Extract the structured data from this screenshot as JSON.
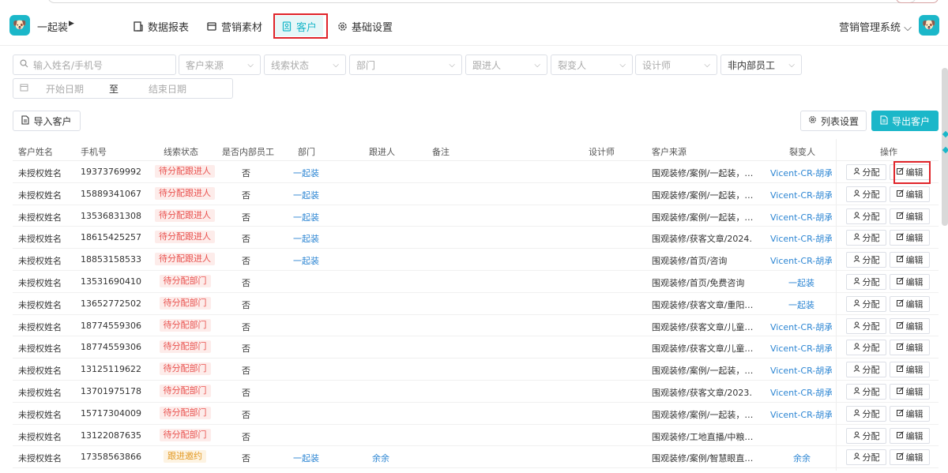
{
  "header": {
    "brand": "一起装",
    "nav": [
      {
        "label": "数据报表",
        "icon": "report-icon"
      },
      {
        "label": "营销素材",
        "icon": "material-icon"
      },
      {
        "label": "客户",
        "icon": "customer-icon",
        "active": true
      },
      {
        "label": "基础设置",
        "icon": "gear-icon"
      }
    ],
    "system": "营销管理系统",
    "accent": "#1bb7c9"
  },
  "filters": {
    "search_placeholder": "输入姓名/手机号",
    "source": "客户来源",
    "status": "线索状态",
    "dept": "部门",
    "follower": "跟进人",
    "splitter": "裂变人",
    "designer": "设计师",
    "employee": "非内部员工",
    "start": "开始日期",
    "to": "至",
    "end": "结束日期"
  },
  "actions": {
    "import": "导入客户",
    "columns": "列表设置",
    "export": "导出客户"
  },
  "table": {
    "headers": [
      "客户姓名",
      "手机号",
      "线索状态",
      "是否内部员工",
      "部门",
      "跟进人",
      "备注",
      "设计师",
      "客户来源",
      "裂变人",
      "操作"
    ],
    "assign_label": "分配",
    "edit_label": "编辑",
    "rows": [
      {
        "name": "未授权姓名",
        "phone": "19373769992",
        "status": "待分配跟进人",
        "status_color": "red",
        "internal": "否",
        "dept": "一起装",
        "follower": "",
        "source": "围观装修/案例/一起装，…",
        "splitter": "Vicent-CR-胡承仁"
      },
      {
        "name": "未授权姓名",
        "phone": "15889341067",
        "status": "待分配跟进人",
        "status_color": "red",
        "internal": "否",
        "dept": "一起装",
        "follower": "",
        "source": "围观装修/案例/一起装，…",
        "splitter": "Vicent-CR-胡承仁"
      },
      {
        "name": "未授权姓名",
        "phone": "13536831308",
        "status": "待分配跟进人",
        "status_color": "red",
        "internal": "否",
        "dept": "一起装",
        "follower": "",
        "source": "围观装修/案例/一起装，…",
        "splitter": "Vicent-CR-胡承仁"
      },
      {
        "name": "未授权姓名",
        "phone": "18615425257",
        "status": "待分配跟进人",
        "status_color": "red",
        "internal": "否",
        "dept": "一起装",
        "follower": "",
        "source": "围观装修/获客文章/2024…",
        "splitter": "Vicent-CR-胡承仁"
      },
      {
        "name": "未授权姓名",
        "phone": "18853158533",
        "status": "待分配跟进人",
        "status_color": "red",
        "internal": "否",
        "dept": "一起装",
        "follower": "",
        "source": "围观装修/首页/咨询",
        "splitter": "Vicent-CR-胡承仁"
      },
      {
        "name": "未授权姓名",
        "phone": "13531690410",
        "status": "待分配部门",
        "status_color": "red",
        "internal": "否",
        "dept": "",
        "follower": "",
        "source": "围观装修/首页/免费咨询",
        "splitter": "一起装"
      },
      {
        "name": "未授权姓名",
        "phone": "13652772502",
        "status": "待分配部门",
        "status_color": "red",
        "internal": "否",
        "dept": "",
        "follower": "",
        "source": "围观装修/获客文章/重阳…",
        "splitter": "一起装"
      },
      {
        "name": "未授权姓名",
        "phone": "18774559306",
        "status": "待分配部门",
        "status_color": "red",
        "internal": "否",
        "dept": "",
        "follower": "",
        "source": "围观装修/获客文章/儿童…",
        "splitter": "Vicent-CR-胡承仁"
      },
      {
        "name": "未授权姓名",
        "phone": "18774559306",
        "status": "待分配部门",
        "status_color": "red",
        "internal": "否",
        "dept": "",
        "follower": "",
        "source": "围观装修/获客文章/儿童…",
        "splitter": "Vicent-CR-胡承仁"
      },
      {
        "name": "未授权姓名",
        "phone": "13125119622",
        "status": "待分配部门",
        "status_color": "red",
        "internal": "否",
        "dept": "",
        "follower": "",
        "source": "围观装修/案例/一起装，…",
        "splitter": "Vicent-CR-胡承仁"
      },
      {
        "name": "未授权姓名",
        "phone": "13701975178",
        "status": "待分配部门",
        "status_color": "red",
        "internal": "否",
        "dept": "",
        "follower": "",
        "source": "围观装修/获客文章/2023…",
        "splitter": "Vicent-CR-胡承仁"
      },
      {
        "name": "未授权姓名",
        "phone": "15717304009",
        "status": "待分配部门",
        "status_color": "red",
        "internal": "否",
        "dept": "",
        "follower": "",
        "source": "围观装修/案例/一起装，…",
        "splitter": "Vicent-CR-胡承仁"
      },
      {
        "name": "未授权姓名",
        "phone": "13122087635",
        "status": "待分配部门",
        "status_color": "red",
        "internal": "否",
        "dept": "",
        "follower": "",
        "source": "围观装修/工地直播/中粮…",
        "splitter": ""
      },
      {
        "name": "未授权姓名",
        "phone": "17358563866",
        "status": "跟进邀约",
        "status_color": "orange",
        "internal": "否",
        "dept": "一起装",
        "follower": "余余",
        "source": "围观装修/案例/智慧眼直…",
        "splitter": "余余"
      }
    ]
  }
}
